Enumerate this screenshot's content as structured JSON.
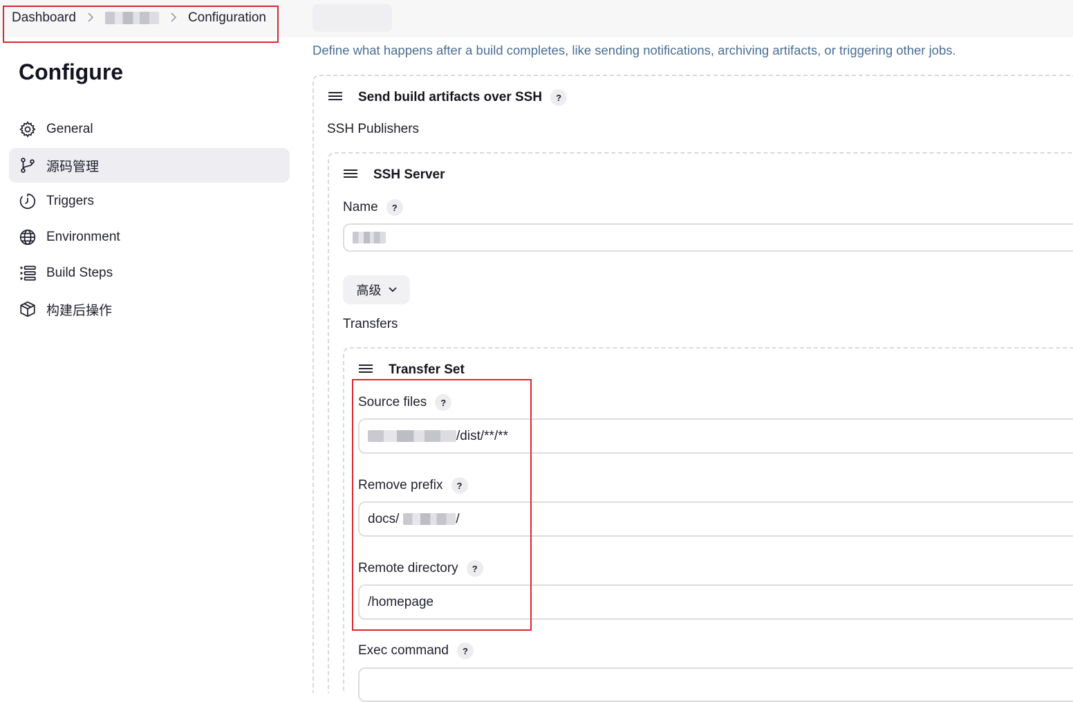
{
  "breadcrumb": {
    "dashboard": "Dashboard",
    "separator": ">",
    "current": "Configuration",
    "project_icon": "pixelated-redacted-text"
  },
  "page": {
    "title": "Configure"
  },
  "nav": {
    "items": [
      {
        "label": "General",
        "icon": "gear-icon",
        "active": false
      },
      {
        "label": "源码管理",
        "icon": "git-branch-icon",
        "active": true
      },
      {
        "label": "Triggers",
        "icon": "clock-icon",
        "active": false
      },
      {
        "label": "Environment",
        "icon": "globe-icon",
        "active": false
      },
      {
        "label": "Build Steps",
        "icon": "list-icon",
        "active": false
      },
      {
        "label": "构建后操作",
        "icon": "package-icon",
        "active": false
      }
    ]
  },
  "main": {
    "description": "Define what happens after a build completes, like sending notifications, archiving artifacts, or triggering other jobs.",
    "publisher": {
      "title": "Send build artifacts over SSH",
      "help": "?",
      "ssh_publishers_label": "SSH Publishers",
      "server": {
        "title": "SSH Server",
        "name_label": "Name",
        "name_help": "?",
        "advanced_label": "高级",
        "transfers_label": "Transfers",
        "transfer_set": {
          "title": "Transfer Set",
          "source_files_label": "Source files",
          "source_files_help": "?",
          "source_files_value": "/dist/**/**",
          "remove_prefix_label": "Remove prefix",
          "remove_prefix_help": "?",
          "remove_prefix_value_start": "docs/",
          "remove_prefix_value_end": "/",
          "remote_directory_label": "Remote directory",
          "remote_directory_help": "?",
          "remote_directory_value": "/homepage",
          "exec_command_label": "Exec command",
          "exec_command_help": "?",
          "exec_command_value": ""
        }
      }
    }
  },
  "colors": {
    "annotation_red": "#d8262e",
    "description_blue": "#4a6e93",
    "active_nav_bg": "#ededf2"
  }
}
